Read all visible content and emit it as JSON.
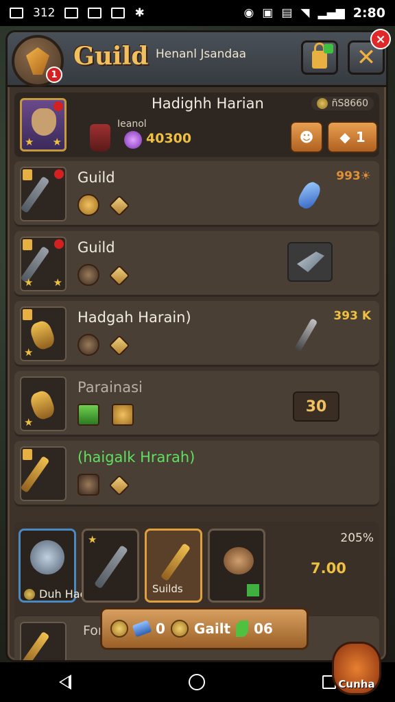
{
  "status_bar": {
    "left_text": "312",
    "time": "2:80"
  },
  "header": {
    "title": "Guild",
    "subtitle": "Henanl Jsandaa",
    "emblem_badge": "1",
    "close_label": "✕",
    "corner_close": "×"
  },
  "top_info": {
    "name": "Hadighh Harian",
    "label": "Ieanol",
    "value": "40300",
    "corner_text": "ñS8660",
    "button_right_value": "1"
  },
  "rows": [
    {
      "title": "Guild",
      "right": "993☀"
    },
    {
      "title": "Guild",
      "right": ""
    },
    {
      "title": "Hadgah Harain)",
      "right": "393 K"
    },
    {
      "title": "Parainasi",
      "right": "",
      "box_value": "30"
    },
    {
      "title": "(haigalk Hrarah)",
      "right": ""
    }
  ],
  "cards": {
    "hero_label": "Duh Haclias",
    "selected_label": "Suilds",
    "top_right": "205%",
    "value": "7.00"
  },
  "partial_row": {
    "title": "Fon"
  },
  "resources": {
    "gem_count": "0",
    "guild_label": "Gailt",
    "leaf_count": "06"
  },
  "hero_button": {
    "label": "Cunha"
  },
  "colors": {
    "accent": "#f0c040",
    "panel": "#3d332a",
    "alert": "#d42020"
  }
}
